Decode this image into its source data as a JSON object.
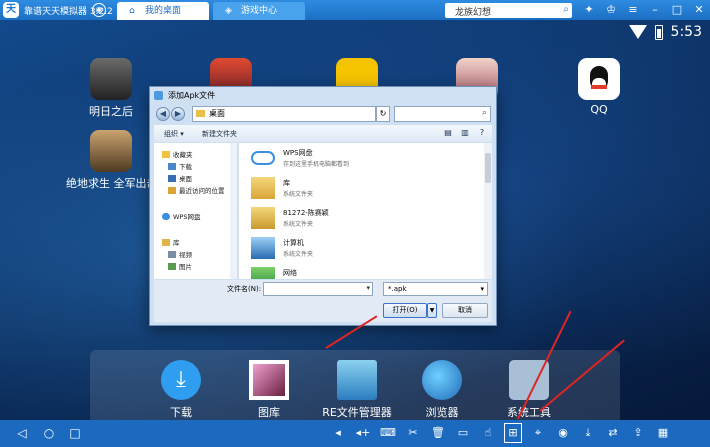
{
  "window": {
    "title": "靠谱天天模拟器 3.2.2",
    "tabs": [
      {
        "label": "我的桌面",
        "active": true
      },
      {
        "label": "游戏中心",
        "active": false
      }
    ],
    "search_value": "龙族幻想"
  },
  "status_bar": {
    "time": "5:53"
  },
  "desktop_apps": [
    {
      "label": "明日之后",
      "color": "#3b3b3b"
    },
    {
      "label": "绝地求生 全军出击",
      "color": "#6b4e2e"
    },
    {
      "label": "QQ",
      "color": "#ffffff"
    }
  ],
  "dock_apps": [
    {
      "label": "下载",
      "color": "#2f9df0"
    },
    {
      "label": "图库",
      "color": "#5a2a3e"
    },
    {
      "label": "RE文件管理器",
      "color": "#3da0d8"
    },
    {
      "label": "浏览器",
      "color": "#2c8ad6"
    },
    {
      "label": "系统工具",
      "color": "#7c9ebd"
    }
  ],
  "dialog": {
    "title": "添加Apk文件",
    "address": "桌面",
    "toolbar": {
      "organize": "组织 ▾",
      "new_folder": "新建文件夹"
    },
    "nav_items": [
      {
        "label": "收藏夹",
        "type": "group"
      },
      {
        "label": "下载",
        "type": "item"
      },
      {
        "label": "桌面",
        "type": "item"
      },
      {
        "label": "最近访问的位置",
        "type": "item"
      },
      {
        "label": "WPS网盘",
        "type": "group"
      },
      {
        "label": "库",
        "type": "group"
      },
      {
        "label": "视频",
        "type": "item"
      },
      {
        "label": "图片",
        "type": "item"
      }
    ],
    "files": [
      {
        "name": "WPS网盘",
        "desc": "存到这里手机电脑都看到"
      },
      {
        "name": "库",
        "desc": "系统文件夹"
      },
      {
        "name": "81272-陈赛颖",
        "desc": "系统文件夹"
      },
      {
        "name": "计算机",
        "desc": "系统文件夹"
      },
      {
        "name": "网络",
        "desc": ""
      }
    ],
    "filename_label": "文件名(N):",
    "filename_value": "",
    "filetype_value": "*.apk",
    "open_button": "打开(O)",
    "cancel_button": "取消"
  }
}
